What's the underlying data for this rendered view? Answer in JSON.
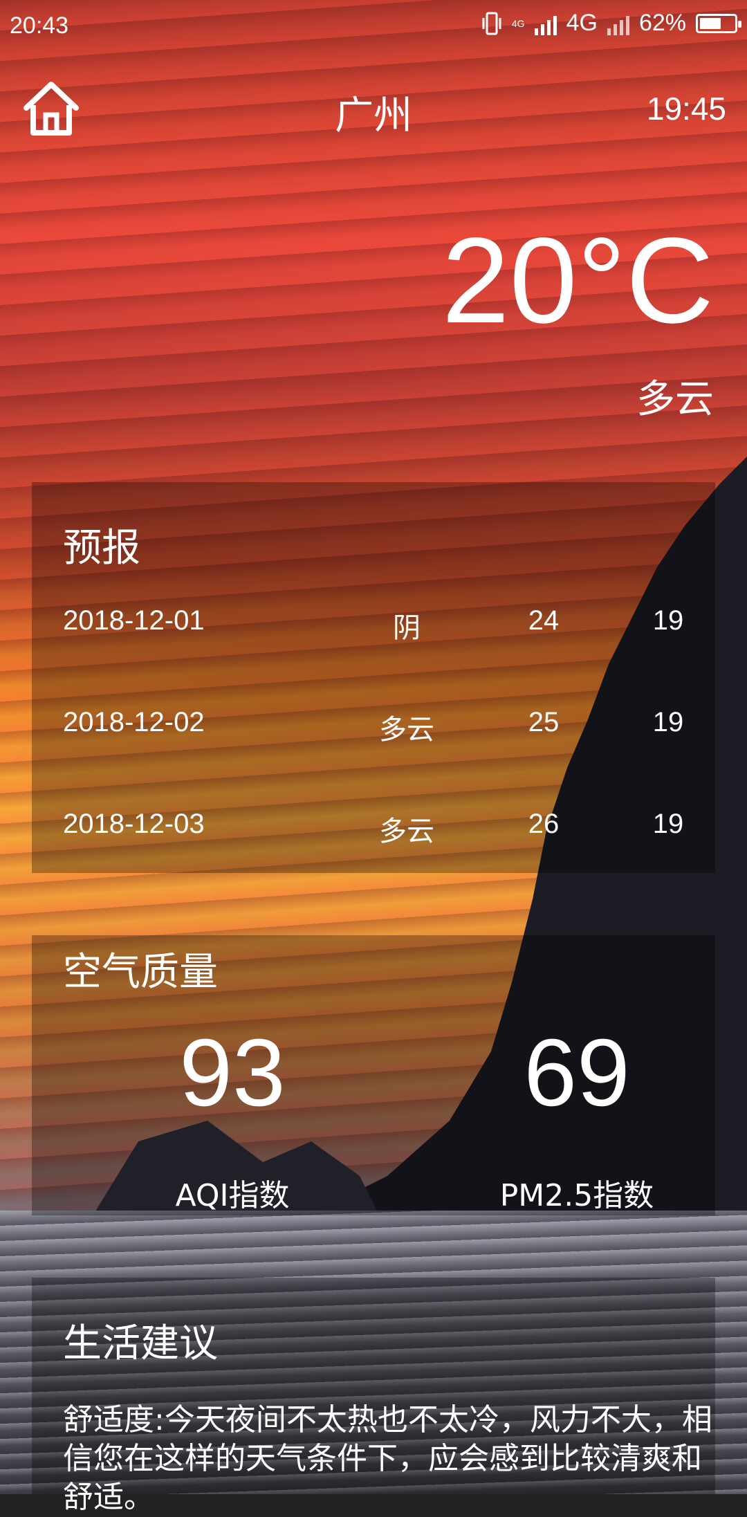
{
  "status_bar": {
    "time": "20:43",
    "net_small": "4G",
    "net_type": "4G",
    "battery_percent": "62%",
    "battery_level": 0.62
  },
  "header": {
    "city": "广州",
    "update_time": "19:45"
  },
  "now": {
    "temperature": "20°C",
    "condition": "多云"
  },
  "forecast": {
    "title": "预报",
    "rows": [
      {
        "date": "2018-12-01",
        "condition": "阴",
        "max": "24",
        "min": "19"
      },
      {
        "date": "2018-12-02",
        "condition": "多云",
        "max": "25",
        "min": "19"
      },
      {
        "date": "2018-12-03",
        "condition": "多云",
        "max": "26",
        "min": "19"
      }
    ]
  },
  "aqi": {
    "title": "空气质量",
    "aqi_value": "93",
    "aqi_label": "AQI指数",
    "pm25_value": "69",
    "pm25_label": "PM2.5指数"
  },
  "suggestion": {
    "title": "生活建议",
    "comfort": "舒适度:今天夜间不太热也不太冷，风力不大，相信您在这样的天气条件下，应会感到比较清爽和舒适。"
  },
  "icons": {
    "home": "home-icon",
    "vibrate": "vibrate-icon",
    "signal": "signal-icon",
    "battery": "battery-icon"
  }
}
